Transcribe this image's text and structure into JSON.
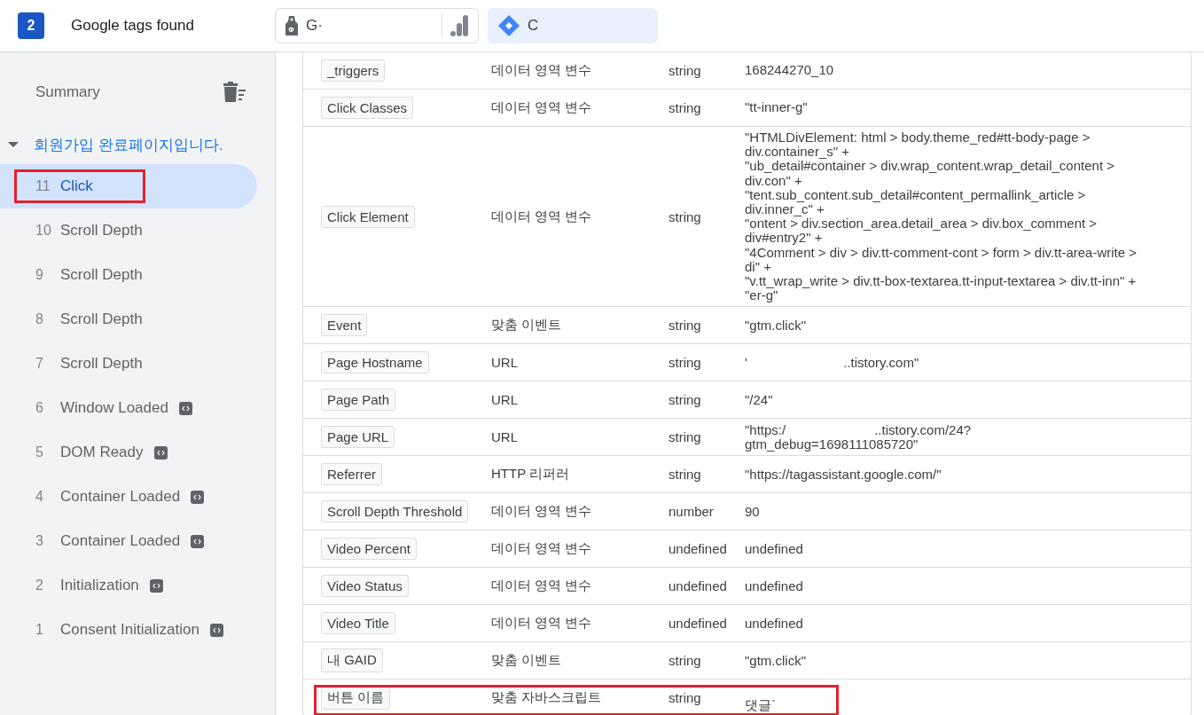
{
  "header": {
    "count": "2",
    "title": "Google tags found",
    "tags": [
      {
        "kind": "gtag",
        "label": "G·",
        "selected": false
      },
      {
        "kind": "gtm",
        "label": "C",
        "selected": true
      }
    ]
  },
  "sidebar": {
    "summary": "Summary",
    "page": {
      "title": "회원가입 완료페이지입니다.",
      "expanded": true,
      "events": [
        {
          "number": "11",
          "name": "Click",
          "selected": true,
          "highlighted": true,
          "code": false
        },
        {
          "number": "10",
          "name": "Scroll Depth",
          "selected": false,
          "highlighted": false,
          "code": false
        },
        {
          "number": "9",
          "name": "Scroll Depth",
          "selected": false,
          "highlighted": false,
          "code": false
        },
        {
          "number": "8",
          "name": "Scroll Depth",
          "selected": false,
          "highlighted": false,
          "code": false
        },
        {
          "number": "7",
          "name": "Scroll Depth",
          "selected": false,
          "highlighted": false,
          "code": false
        },
        {
          "number": "6",
          "name": "Window Loaded",
          "selected": false,
          "highlighted": false,
          "code": true
        },
        {
          "number": "5",
          "name": "DOM Ready",
          "selected": false,
          "highlighted": false,
          "code": true
        },
        {
          "number": "4",
          "name": "Container Loaded",
          "selected": false,
          "highlighted": false,
          "code": true
        },
        {
          "number": "3",
          "name": "Container Loaded",
          "selected": false,
          "highlighted": false,
          "code": true
        },
        {
          "number": "2",
          "name": "Initialization",
          "selected": false,
          "highlighted": false,
          "code": true
        },
        {
          "number": "1",
          "name": "Consent Initialization",
          "selected": false,
          "highlighted": false,
          "code": true
        }
      ]
    }
  },
  "variables": [
    {
      "name": "_triggers",
      "type": "데이터 영역 변수",
      "data_type": "string",
      "value": "168244270_10",
      "highlighted": false
    },
    {
      "name": "Click Classes",
      "type": "데이터 영역 변수",
      "data_type": "string",
      "value": "\"tt-inner-g\"",
      "highlighted": false
    },
    {
      "name": "Click Element",
      "type": "데이터 영역 변수",
      "data_type": "string",
      "value": "\"HTMLDivElement: html > body.theme_red#tt-body-page >\ndiv.container_s\" +\n\"ub_detail#container > div.wrap_content.wrap_detail_content >\ndiv.con\" +\n\"tent.sub_content.sub_detail#content_permallink_article >\ndiv.inner_c\" +\n\"ontent > div.section_area.detail_area > div.box_comment >\ndiv#entry2\" +\n\"4Comment > div > div.tt-comment-cont > form > div.tt-area-write >\ndi\" +\n\"v.tt_wrap_write > div.tt-box-textarea.tt-input-textarea > div.tt-inn\" +\n\"er-g\"",
      "highlighted": false
    },
    {
      "name": "Event",
      "type": "맞춤 이벤트",
      "data_type": "string",
      "value": "\"gtm.click\"",
      "highlighted": false
    },
    {
      "name": "Page Hostname",
      "type": "URL",
      "data_type": "string",
      "value": "'                          ..tistory.com\"",
      "highlighted": false
    },
    {
      "name": "Page Path",
      "type": "URL",
      "data_type": "string",
      "value": "\"/24\"",
      "highlighted": false
    },
    {
      "name": "Page URL",
      "type": "URL",
      "data_type": "string",
      "value": "\"https:/                        ..tistory.com/24?\ngtm_debug=1698111085720\"",
      "highlighted": false
    },
    {
      "name": "Referrer",
      "type": "HTTP 리퍼러",
      "data_type": "string",
      "value": "\"https://tagassistant.google.com/\"",
      "highlighted": false
    },
    {
      "name": "Scroll Depth Threshold",
      "type": "데이터 영역 변수",
      "data_type": "number",
      "value": "90",
      "highlighted": false
    },
    {
      "name": "Video Percent",
      "type": "데이터 영역 변수",
      "data_type": "undefined",
      "value": "undefined",
      "highlighted": false
    },
    {
      "name": "Video Status",
      "type": "데이터 영역 변수",
      "data_type": "undefined",
      "value": "undefined",
      "highlighted": false
    },
    {
      "name": "Video Title",
      "type": "데이터 영역 변수",
      "data_type": "undefined",
      "value": "undefined",
      "highlighted": false
    },
    {
      "name": "내 GAID",
      "type": "맞춤 이벤트",
      "data_type": "string",
      "value": "\"gtm.click\"",
      "highlighted": false
    },
    {
      "name": "버튼 이름",
      "type": "맞춤 자바스크립트",
      "data_type": "string",
      "value": "\n댓글`",
      "highlighted": true
    }
  ]
}
